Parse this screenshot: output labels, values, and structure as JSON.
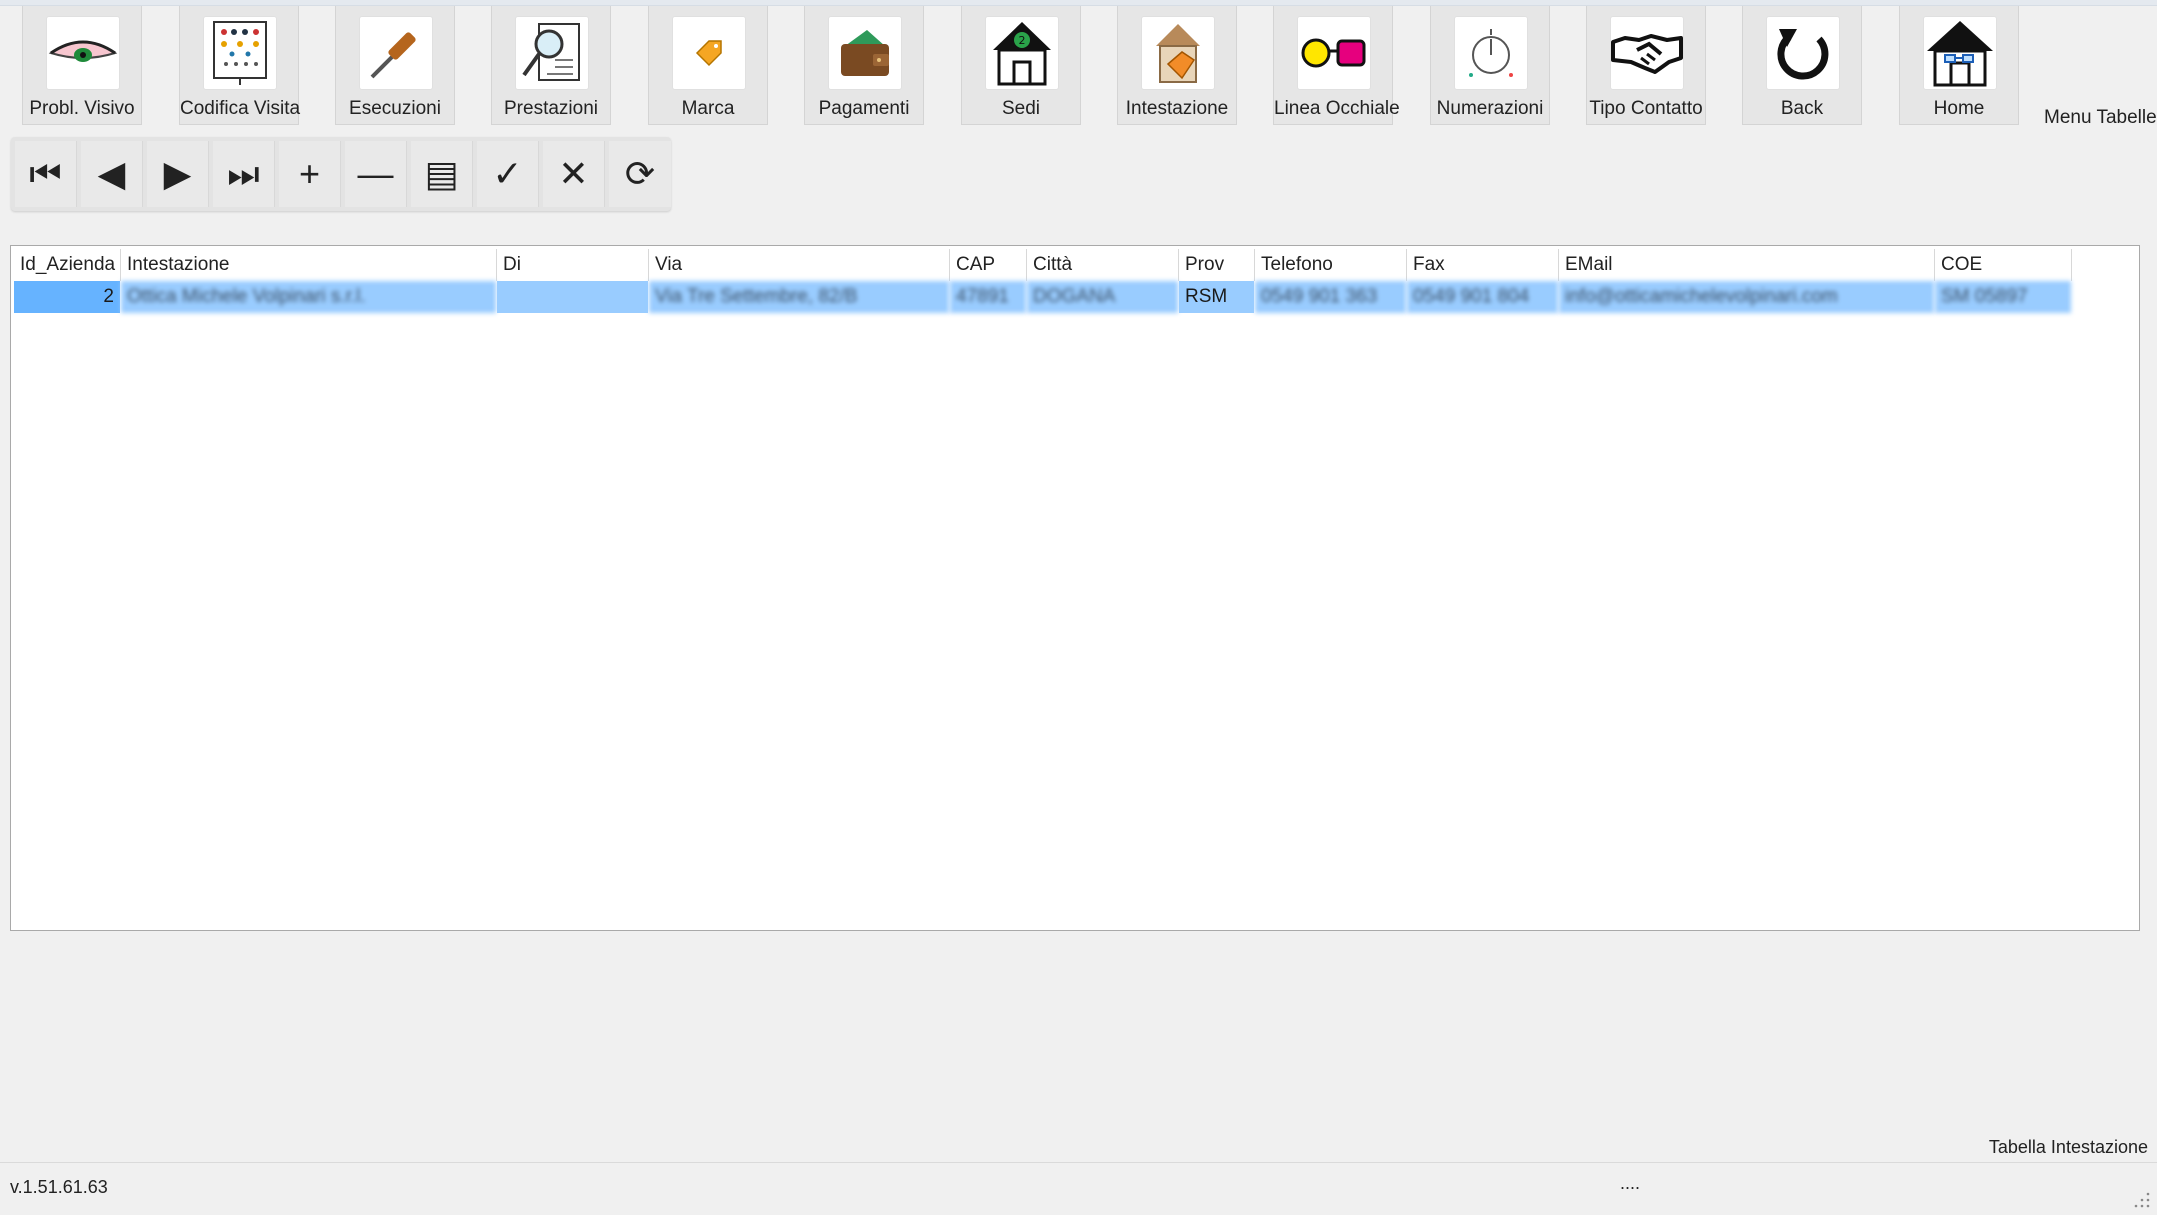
{
  "ribbon": {
    "tiles": [
      {
        "label": "Probl. Visivo",
        "icon": "eye-icon"
      },
      {
        "label": "Codifica Visita",
        "icon": "eye-chart-icon"
      },
      {
        "label": "Esecuzioni",
        "icon": "screwdriver-icon"
      },
      {
        "label": "Prestazioni",
        "icon": "magnifier-document-icon"
      },
      {
        "label": "Marca",
        "icon": "brand-tag-icon"
      },
      {
        "label": "Pagamenti",
        "icon": "wallet-icon"
      },
      {
        "label": "Sedi",
        "icon": "branch-house-icon"
      },
      {
        "label": "Intestazione",
        "icon": "header-tag-icon"
      },
      {
        "label": "Linea Occhiale",
        "icon": "glasses-line-icon"
      },
      {
        "label": "Numerazioni",
        "icon": "numbering-icon"
      },
      {
        "label": "Tipo Contatto",
        "icon": "handshake-icon"
      },
      {
        "label": "Back",
        "icon": "back-arrow-icon"
      },
      {
        "label": "Home",
        "icon": "home-icon"
      }
    ],
    "menu_label": "Menu Tabelle"
  },
  "navigator": {
    "buttons": [
      "first-record",
      "previous-record",
      "next-record",
      "last-record",
      "add-record",
      "delete-record",
      "edit-record",
      "confirm",
      "cancel",
      "refresh"
    ],
    "glyphs": [
      "⏮",
      "◀",
      "▶",
      "⏭",
      "+",
      "—",
      "▤",
      "✓",
      "✕",
      "⟳"
    ]
  },
  "grid": {
    "columns": [
      "Id_Azienda",
      "Intestazione",
      "Di",
      "Via",
      "CAP",
      "Città",
      "Prov",
      "Telefono",
      "Fax",
      "EMail",
      "COE"
    ],
    "row": {
      "id": "2",
      "intestazione": "Ottica Michele Volpinari s.r.l.",
      "di": "",
      "via": "Via Tre Settembre, 82/B",
      "cap": "47891",
      "citta": "DOGANA",
      "prov": "RSM",
      "telefono": "0549 901 363",
      "fax": "0549 901 804",
      "email": "info@otticamichelevolpinari.com",
      "coe": "SM 05897"
    }
  },
  "footer": {
    "table_label": "Tabella Intestazione",
    "version": "v.1.51.61.63",
    "status": "...."
  }
}
